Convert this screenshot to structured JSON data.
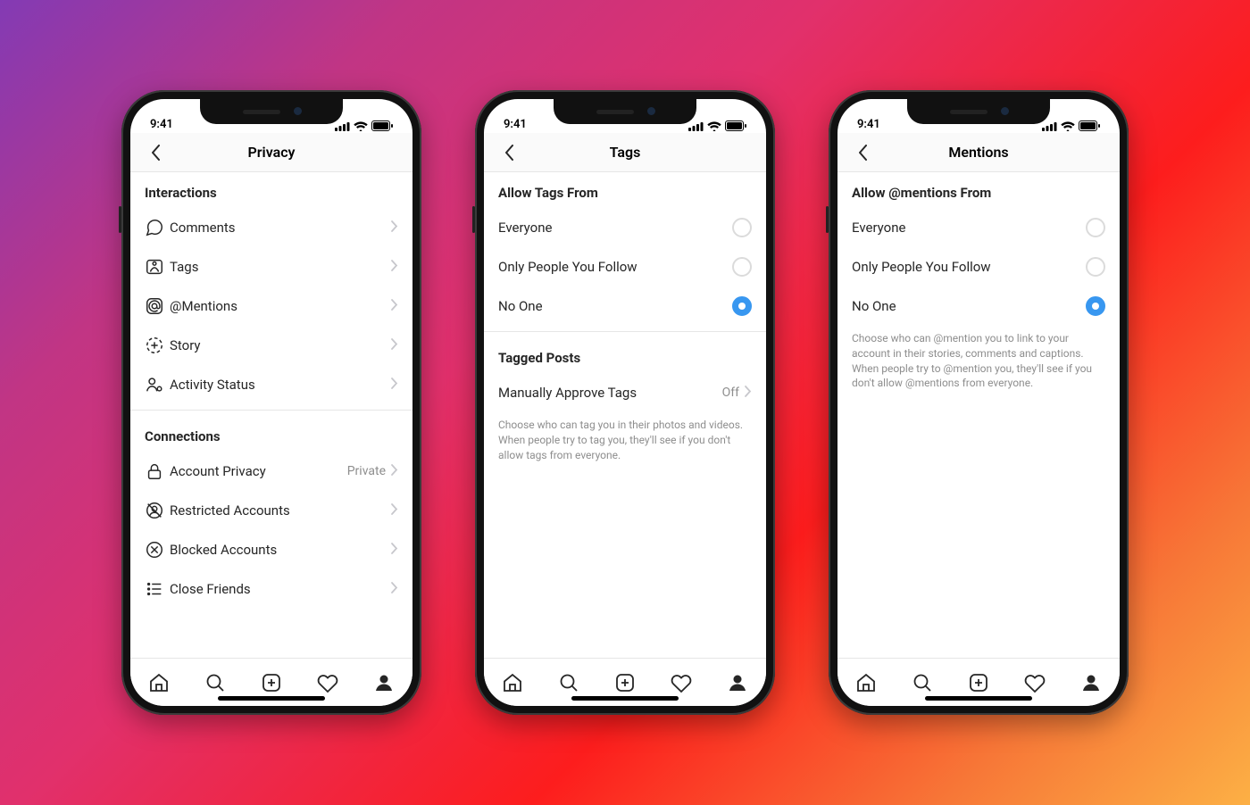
{
  "status": {
    "time": "9:41"
  },
  "screens": [
    {
      "title": "Privacy",
      "sections": [
        {
          "heading": "Interactions",
          "rows": [
            {
              "icon": "comment-icon",
              "label": "Comments"
            },
            {
              "icon": "tag-icon",
              "label": "Tags"
            },
            {
              "icon": "mention-icon",
              "label": "@Mentions"
            },
            {
              "icon": "story-icon",
              "label": "Story"
            },
            {
              "icon": "activity-icon",
              "label": "Activity Status"
            }
          ]
        },
        {
          "heading": "Connections",
          "rows": [
            {
              "icon": "lock-icon",
              "label": "Account Privacy",
              "meta": "Private"
            },
            {
              "icon": "restricted-icon",
              "label": "Restricted Accounts"
            },
            {
              "icon": "blocked-icon",
              "label": "Blocked Accounts"
            },
            {
              "icon": "close-friends-icon",
              "label": "Close Friends"
            }
          ]
        }
      ]
    },
    {
      "title": "Tags",
      "radio_heading": "Allow Tags From",
      "options": [
        {
          "label": "Everyone",
          "selected": false
        },
        {
          "label": "Only People You Follow",
          "selected": false
        },
        {
          "label": "No One",
          "selected": true
        }
      ],
      "sub_heading": "Tagged Posts",
      "sub_row": {
        "label": "Manually Approve Tags",
        "meta": "Off"
      },
      "help": "Choose who can tag you in their photos and videos. When people try to tag you, they'll see if you don't allow tags from everyone."
    },
    {
      "title": "Mentions",
      "radio_heading": "Allow @mentions From",
      "options": [
        {
          "label": "Everyone",
          "selected": false
        },
        {
          "label": "Only People You Follow",
          "selected": false
        },
        {
          "label": "No One",
          "selected": true
        }
      ],
      "help": "Choose who can @mention you to link to your account in their stories, comments and captions. When people try to @mention you, they'll see if you don't allow @mentions from everyone."
    }
  ]
}
